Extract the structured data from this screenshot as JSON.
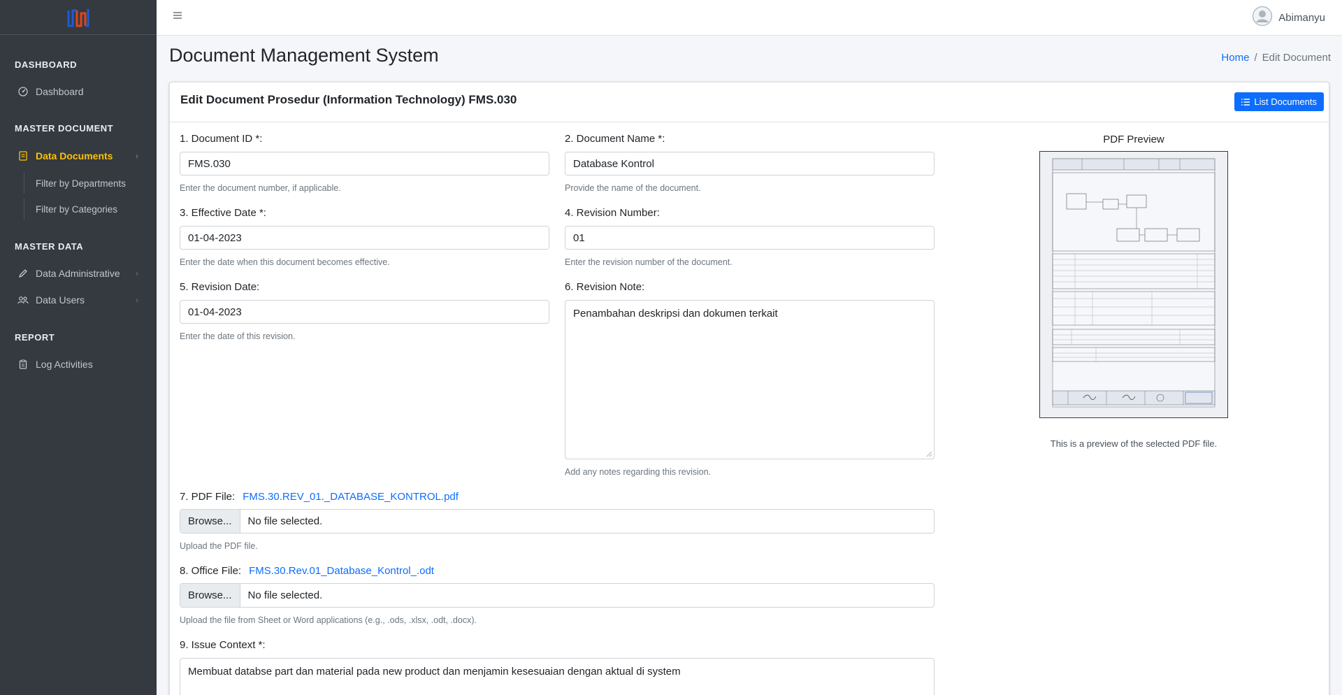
{
  "brand": {
    "logo": "logo-fln"
  },
  "sidebar": {
    "sections": [
      {
        "title": "DASHBOARD"
      },
      {
        "title": "MASTER DOCUMENT"
      },
      {
        "title": "MASTER DATA"
      },
      {
        "title": "REPORT"
      }
    ],
    "items": {
      "dashboard": "Dashboard",
      "data_documents": "Data Documents",
      "filter_departments": "Filter by Departments",
      "filter_categories": "Filter by Categories",
      "data_administrative": "Data Administrative",
      "data_users": "Data Users",
      "log_activities": "Log Activities"
    }
  },
  "header": {
    "user_name": "Abimanyu"
  },
  "page": {
    "title": "Document Management System",
    "breadcrumb": {
      "home": "Home",
      "current": "Edit Document"
    }
  },
  "card": {
    "title": "Edit Document Prosedur (Information Technology) FMS.030",
    "list_button": "List Documents"
  },
  "form": {
    "document_id": {
      "label": "1. Document ID *:",
      "value": "FMS.030",
      "help": "Enter the document number, if applicable."
    },
    "document_name": {
      "label": "2. Document Name *:",
      "value": "Database Kontrol",
      "help": "Provide the name of the document."
    },
    "effective_date": {
      "label": "3. Effective Date *:",
      "value": "01-04-2023",
      "help": "Enter the date when this document becomes effective."
    },
    "revision_number": {
      "label": "4. Revision Number:",
      "value": "01",
      "help": "Enter the revision number of the document."
    },
    "revision_date": {
      "label": "5. Revision Date:",
      "value": "01-04-2023",
      "help": "Enter the date of this revision."
    },
    "revision_note": {
      "label": "6. Revision Note:",
      "value": "Penambahan deskripsi dan dokumen terkait",
      "help": "Add any notes regarding this revision."
    },
    "pdf_file": {
      "label": "7. PDF File:",
      "link": "FMS.30.REV_01._DATABASE_KONTROL.pdf",
      "browse": "Browse...",
      "status": "No file selected.",
      "help": "Upload the PDF file."
    },
    "office_file": {
      "label": "8. Office File:",
      "link": "FMS.30.Rev.01_Database_Kontrol_.odt",
      "browse": "Browse...",
      "status": "No file selected.",
      "help": "Upload the file from Sheet or Word applications (e.g., .ods, .xlsx, .odt, .docx)."
    },
    "issue_context": {
      "label": "9. Issue Context *:",
      "value": "Membuat databse part dan material pada new product dan menjamin kesesuaian dengan aktual di system"
    }
  },
  "preview": {
    "title": "PDF Preview",
    "caption": "This is a preview of the selected PDF file."
  },
  "colors": {
    "sidebar": "#343a40",
    "accent": "#ffc107",
    "primary": "#0d6efd"
  }
}
